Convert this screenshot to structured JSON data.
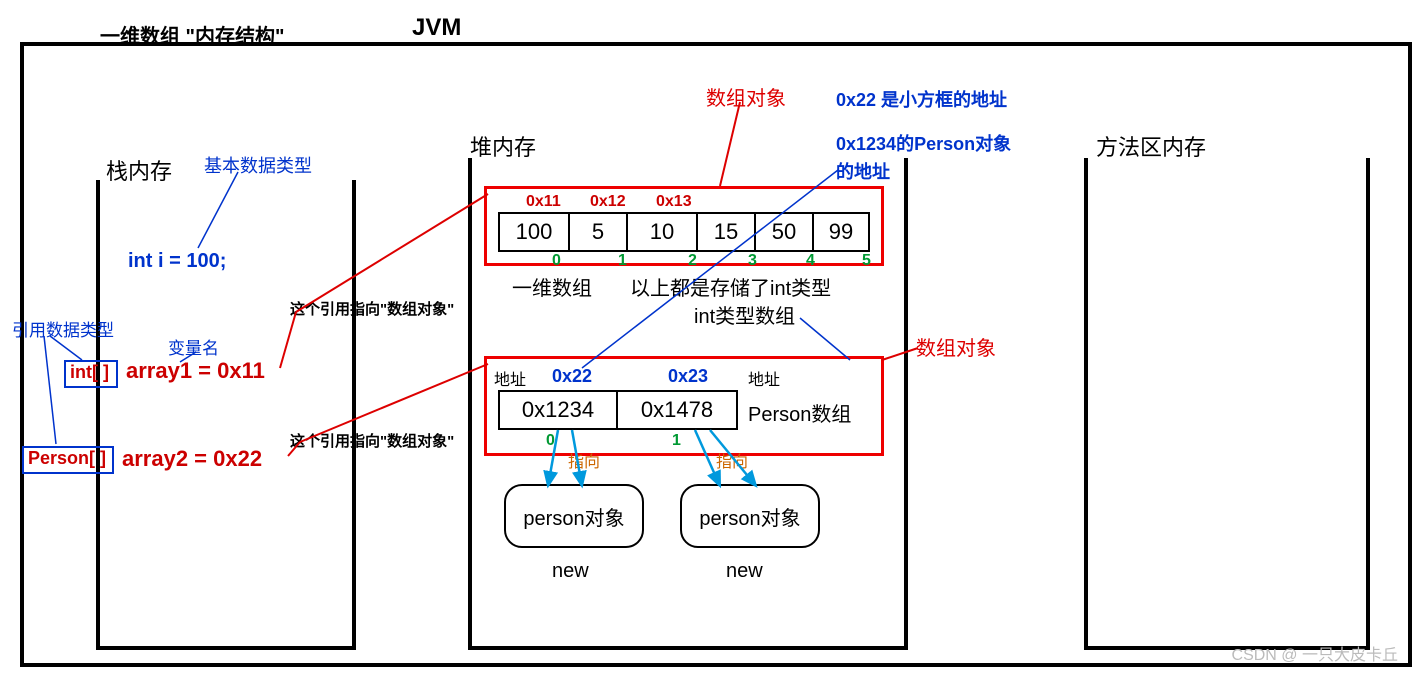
{
  "title": "一维数组 \"内存结构\"",
  "jvm_label": "JVM",
  "stack": {
    "title": "栈内存",
    "primitive_label": "基本数据类型",
    "int_decl": "int i = 100;",
    "ref_type_label": "引用数据类型",
    "var_name_label": "变量名",
    "int_arr_type": "int[ ]",
    "array1_decl": "array1 = 0x11",
    "person_arr_type": "Person[ ]",
    "array2_decl": "array2 = 0x22",
    "ref_note1": "这个引用指向\"数组对象\"",
    "ref_note2": "这个引用指向\"数组对象\""
  },
  "heap": {
    "title": "堆内存",
    "array_obj_label": "数组对象",
    "int_array": {
      "addresses": [
        "0x11",
        "0x12",
        "0x13"
      ],
      "values": [
        "100",
        "5",
        "10",
        "15",
        "50",
        "99"
      ],
      "indices": [
        "0",
        "1",
        "2",
        "3",
        "4",
        "5"
      ]
    },
    "int_array_caption1": "一维数组",
    "int_array_caption2": "以上都是存储了int类型",
    "int_array_caption3": "int类型数组",
    "person_array": {
      "addr_label1": "地址",
      "addr_label2": "地址",
      "addresses": [
        "0x22",
        "0x23"
      ],
      "values": [
        "0x1234",
        "0x1478"
      ],
      "indices": [
        "0",
        "1"
      ],
      "person_label": "Person数组"
    },
    "array_obj_label2": "数组对象",
    "pointer_label": "指向",
    "person_obj1": "person对象",
    "person_obj2": "person对象",
    "new_label": "new"
  },
  "method_area": {
    "title": "方法区内存"
  },
  "notes": {
    "line1": "0x22 是小方框的地址",
    "line2": "0x1234的Person对象",
    "line3": "的地址"
  },
  "watermark": "CSDN @ 一只大皮卡丘"
}
